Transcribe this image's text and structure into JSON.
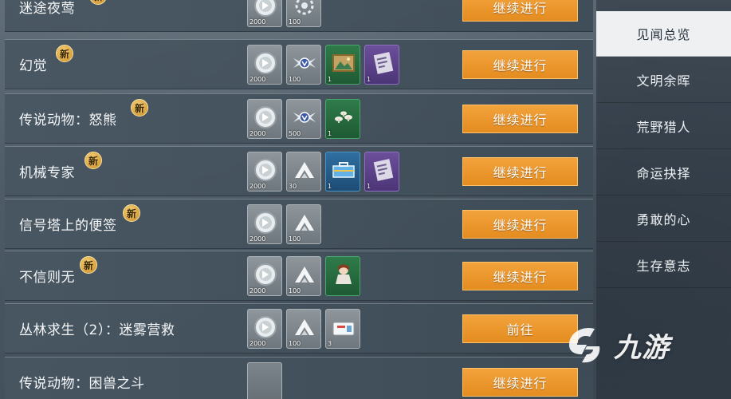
{
  "quests": [
    {
      "name": "迷途夜莺",
      "is_new": true,
      "action": "继续进行",
      "rewards": [
        {
          "icon": "silver-coin-icon",
          "rarity": "common",
          "qty": "2000"
        },
        {
          "icon": "gear-badge-icon",
          "rarity": "common",
          "qty": "100"
        }
      ]
    },
    {
      "name": "幻觉",
      "is_new": true,
      "action": "继续进行",
      "rewards": [
        {
          "icon": "silver-coin-icon",
          "rarity": "common",
          "qty": "2000"
        },
        {
          "icon": "winged-emblem-icon",
          "rarity": "common",
          "qty": "100"
        },
        {
          "icon": "landscape-painting-icon",
          "rarity": "green",
          "qty": "1"
        },
        {
          "icon": "document-card-icon",
          "rarity": "purple",
          "qty": "1"
        }
      ]
    },
    {
      "name": "传说动物：怒熊",
      "is_new": true,
      "action": "继续进行",
      "rewards": [
        {
          "icon": "silver-coin-icon",
          "rarity": "common",
          "qty": "2000"
        },
        {
          "icon": "winged-emblem-icon",
          "rarity": "common",
          "qty": "500"
        },
        {
          "icon": "mushrooms-icon",
          "rarity": "green",
          "qty": "1"
        }
      ]
    },
    {
      "name": "机械专家",
      "is_new": true,
      "action": "继续进行",
      "rewards": [
        {
          "icon": "silver-coin-icon",
          "rarity": "common",
          "qty": "2000"
        },
        {
          "icon": "mountain-badge-icon",
          "rarity": "common",
          "qty": "30"
        },
        {
          "icon": "toolbox-icon",
          "rarity": "blue",
          "qty": "1"
        },
        {
          "icon": "document-card-icon",
          "rarity": "purple",
          "qty": "1"
        }
      ]
    },
    {
      "name": "信号塔上的便签",
      "is_new": true,
      "action": "继续进行",
      "rewards": [
        {
          "icon": "silver-coin-icon",
          "rarity": "common",
          "qty": "2000"
        },
        {
          "icon": "mountain-badge-icon",
          "rarity": "common",
          "qty": "100"
        }
      ]
    },
    {
      "name": "不信则无",
      "is_new": true,
      "action": "继续进行",
      "rewards": [
        {
          "icon": "silver-coin-icon",
          "rarity": "common",
          "qty": "2000"
        },
        {
          "icon": "mountain-badge-icon",
          "rarity": "common",
          "qty": "100"
        },
        {
          "icon": "doll-icon",
          "rarity": "green",
          "qty": ""
        }
      ]
    },
    {
      "name": "丛林求生（2）：迷雾营救",
      "is_new": false,
      "action": "前往",
      "rewards": [
        {
          "icon": "silver-coin-icon",
          "rarity": "common",
          "qty": "2000"
        },
        {
          "icon": "mountain-badge-icon",
          "rarity": "common",
          "qty": "100"
        },
        {
          "icon": "first-aid-kit-icon",
          "rarity": "common",
          "qty": "3"
        }
      ]
    },
    {
      "name": "传说动物：困兽之斗",
      "is_new": false,
      "action": "继续进行",
      "rewards": [
        {
          "icon": "empty-slot-icon",
          "rarity": "empty",
          "qty": ""
        }
      ]
    }
  ],
  "new_badge_label": "新",
  "sidebar": {
    "items": [
      {
        "label": "见闻总览",
        "active": true
      },
      {
        "label": "文明余晖",
        "active": false
      },
      {
        "label": "荒野猎人",
        "active": false
      },
      {
        "label": "命运抉择",
        "active": false
      },
      {
        "label": "勇敢的心",
        "active": false
      },
      {
        "label": "生存意志",
        "active": false
      }
    ]
  },
  "watermark": {
    "text": "九游"
  },
  "colors": {
    "action_button": "#e48c20",
    "active_tab_bg": "#eef0f2"
  }
}
